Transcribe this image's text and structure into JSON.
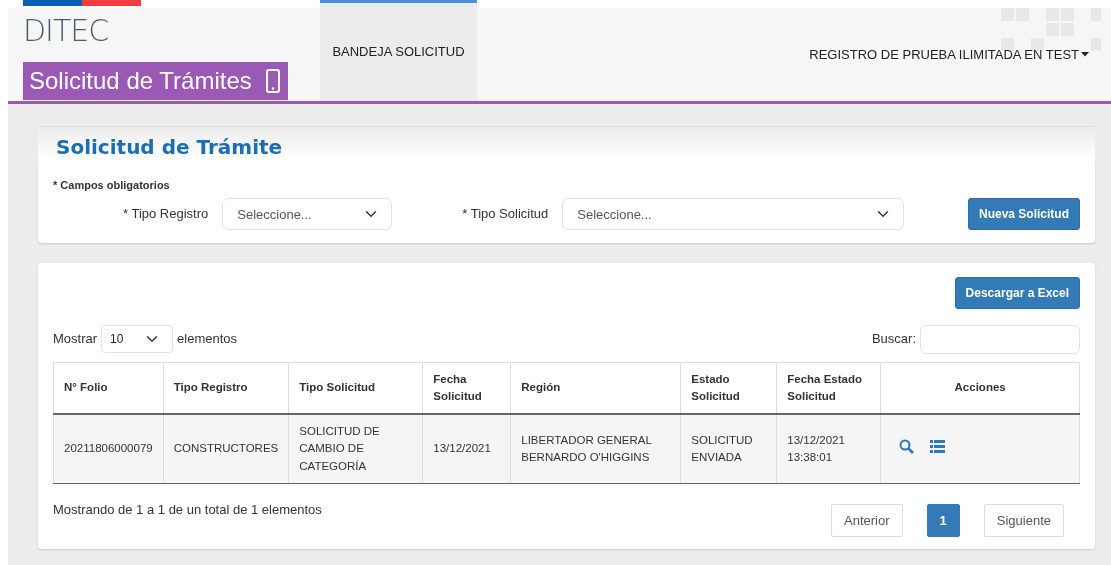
{
  "header": {
    "brand": "DITEC",
    "app_title": "Solicitud de Trámites",
    "nav": [
      {
        "label": "BANDEJA SOLICITUD",
        "selected": true
      }
    ],
    "user_menu": "REGISTRO DE PRUEBA ILIMITADA EN TEST"
  },
  "page_title": "Solicitud de Trámite",
  "filters": {
    "required_note": "* Campos obligatorios",
    "fields": [
      {
        "label": "* Tipo Registro",
        "value": "Seleccione..."
      },
      {
        "label": "* Tipo Solicitud",
        "value": "Seleccione..."
      }
    ],
    "button": "Nueva Solicitud"
  },
  "results": {
    "export_button": "Descargar a Excel",
    "length_prefix": "Mostrar",
    "length_value": "10",
    "length_suffix": "elementos",
    "search_label": "Buscar:",
    "table": {
      "columns": [
        "N° Folio",
        "Tipo Registro",
        "Tipo Solicitud",
        "Fecha Solicitud",
        "Región",
        "Estado Solicitud",
        "Fecha Estado Solicitud",
        "Acciones"
      ],
      "rows": [
        {
          "cells": [
            "20211806000079",
            "CONSTRUCTORES",
            "SOLICITUD DE CAMBIO DE CATEGORÍA",
            "13/12/2021",
            "LIBERTADOR GENERAL BERNARDO O'HIGGINS",
            "SOLICITUD ENVIADA",
            "13/12/2021 13:38:01"
          ]
        }
      ]
    },
    "info": "Mostrando de 1 a 1 de un total de 1 elementos",
    "pagination": [
      {
        "label": "Anterior",
        "selected": false
      },
      {
        "label": "1",
        "selected": true
      },
      {
        "label": "Siguiente",
        "selected": false
      }
    ]
  }
}
